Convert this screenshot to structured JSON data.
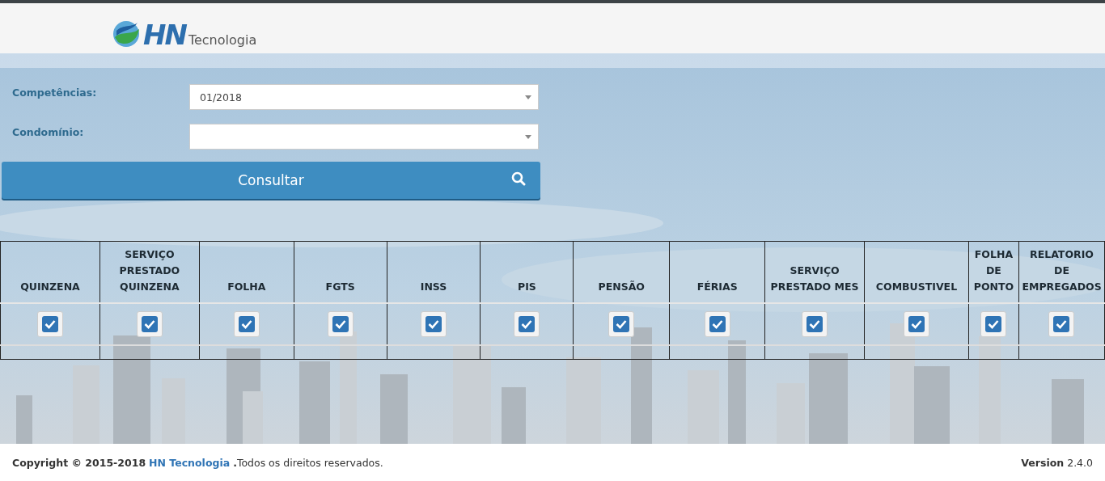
{
  "header": {
    "logo_mark": "HN",
    "logo_text": "Tecnologia"
  },
  "form": {
    "fields": [
      {
        "label": "Competências:",
        "value": "01/2018"
      },
      {
        "label": "Condomínio:"
      }
    ],
    "button": "Consultar"
  },
  "table": {
    "columns": [
      {
        "label": "QUINZENA",
        "checked": true
      },
      {
        "label": "SERVIÇO PRESTADO QUINZENA",
        "checked": true
      },
      {
        "label": "FOLHA",
        "checked": true
      },
      {
        "label": "FGTS",
        "checked": true
      },
      {
        "label": "INSS",
        "checked": true
      },
      {
        "label": "PIS",
        "checked": true
      },
      {
        "label": "PENSÃO",
        "checked": true
      },
      {
        "label": "FÉRIAS",
        "checked": true
      },
      {
        "label": "SERVIÇO PRESTADO MES",
        "checked": true
      },
      {
        "label": "COMBUSTIVEL",
        "checked": true
      },
      {
        "label": "FOLHA DE PONTO",
        "checked": true
      },
      {
        "label": "RELATORIO DE EMPREGADOS",
        "checked": true
      }
    ]
  },
  "footer": {
    "copyright": "**Copyright © 2015-2018** ",
    "link": "HN Tecnologia",
    "rest": " **.**Todos os direitos reservados.",
    "version": "**Version** 2.4.0"
  }
}
